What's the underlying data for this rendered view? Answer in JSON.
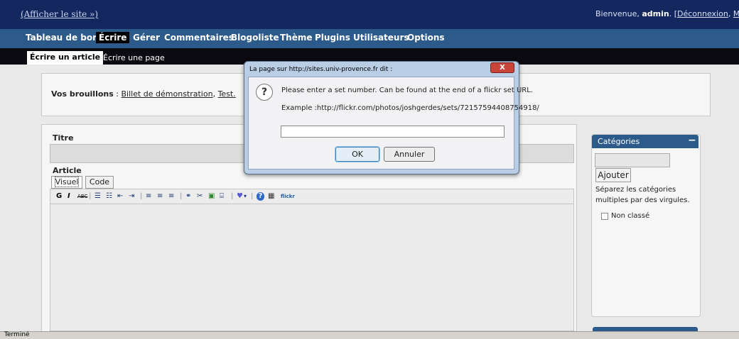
{
  "topbar": {
    "view_site": "(Afficher le site »)",
    "welcome_prefix": "Bienvenue, ",
    "user": "admin",
    "welcome_suffix": ". [",
    "logout": "Déconnexion",
    "separator": ", ",
    "profile": "Mon profil"
  },
  "mainmenu": {
    "items": [
      "Tableau de bord",
      "Écrire",
      "Gérer",
      "Commentaires",
      "Blogoliste",
      "Thème",
      "Plugins",
      "Utilisateurs",
      "Options"
    ],
    "active": "Écrire"
  },
  "submenu": {
    "items": [
      "Écrire un article",
      "Écrire une page"
    ]
  },
  "drafts": {
    "label": "Vos brouillons",
    "sep": " : ",
    "items": [
      "Billet de démonstration",
      "Test."
    ],
    "comma": ", "
  },
  "editor": {
    "title_label": "Titre",
    "article_label": "Article",
    "tab_visual": "Visuel",
    "tab_code": "Code",
    "toolbar": {
      "bold": "G",
      "italic": "I",
      "strike": "ABC",
      "ul": "☰",
      "ol": "☷",
      "outdent": "⇤",
      "indent": "⇥",
      "align_left": "≡",
      "align_center": "≡",
      "align_right": "≡",
      "link": "⚭",
      "unlink": "✂",
      "image": "▣",
      "more": "⌸",
      "spell": "♥",
      "help": "?",
      "kbd": "▦",
      "flickr": "flickr"
    }
  },
  "categories": {
    "title": "Catégories",
    "add_button": "Ajouter",
    "help_line1": "Séparez les catégories",
    "help_line2": "multiples par des virgules.",
    "items": [
      "Non classé"
    ]
  },
  "status": {
    "text": "Terminé"
  },
  "dialog": {
    "title": "La page sur http://sites.univ-provence.fr dit :",
    "close": "X",
    "message": "Please enter a set number. Can be found at the end of a flickr set URL.",
    "example": "Example :http://flickr.com/photos/joshgerdes/sets/72157594408754918/",
    "input_value": "",
    "ok": "OK",
    "cancel": "Annuler"
  }
}
